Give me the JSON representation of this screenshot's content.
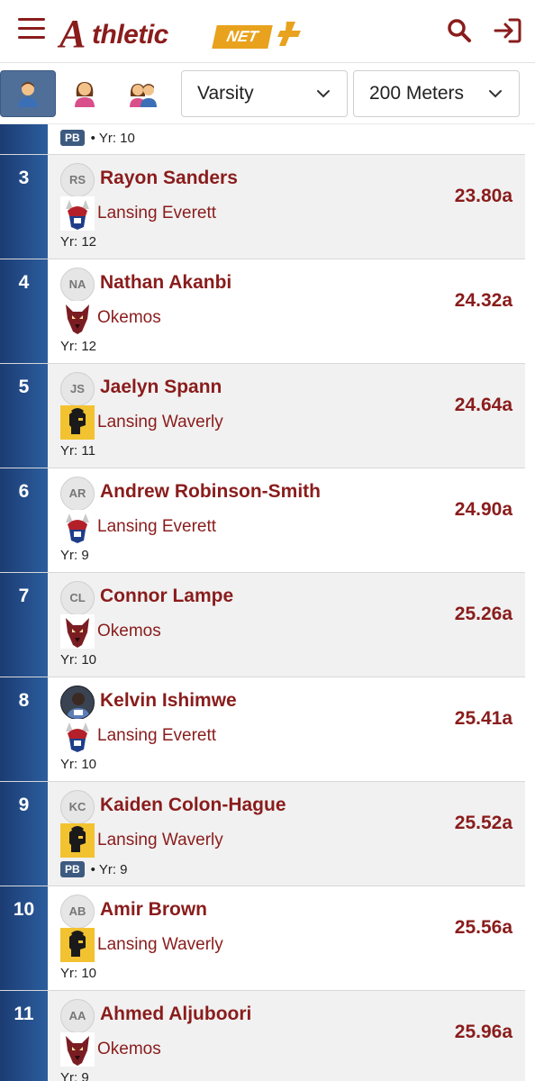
{
  "header": {
    "logo_text_a": "A",
    "logo_text": "thletic",
    "logo_net": "NET"
  },
  "filters": {
    "level": "Varsity",
    "event": "200 Meters",
    "gender_buttons": [
      "boys-icon",
      "girls-icon",
      "both-genders-icon"
    ],
    "active_gender": "boys"
  },
  "partial_row": {
    "pb": "PB",
    "meta": "• Yr: 10"
  },
  "rows": [
    {
      "rank": "3",
      "initials": "RS",
      "name": "Rayon Sanders",
      "school": "Lansing Everett",
      "school_logo": "viking",
      "meta": "Yr: 12",
      "pb": "",
      "mark": "23.80a"
    },
    {
      "rank": "4",
      "initials": "NA",
      "name": "Nathan Akanbi",
      "school": "Okemos",
      "school_logo": "wolf",
      "meta": "Yr: 12",
      "pb": "",
      "mark": "24.32a"
    },
    {
      "rank": "5",
      "initials": "JS",
      "name": "Jaelyn Spann",
      "school": "Lansing Waverly",
      "school_logo": "warrior",
      "meta": "Yr: 11",
      "pb": "",
      "mark": "24.64a"
    },
    {
      "rank": "6",
      "initials": "AR",
      "name": "Andrew Robinson-Smith",
      "school": "Lansing Everett",
      "school_logo": "viking",
      "meta": "Yr: 9",
      "pb": "",
      "mark": "24.90a"
    },
    {
      "rank": "7",
      "initials": "CL",
      "name": "Connor Lampe",
      "school": "Okemos",
      "school_logo": "wolf",
      "meta": "Yr: 10",
      "pb": "",
      "mark": "25.26a"
    },
    {
      "rank": "8",
      "initials": "",
      "name": "Kelvin Ishimwe",
      "school": "Lansing Everett",
      "school_logo": "viking",
      "meta": "Yr: 10",
      "pb": "",
      "mark": "25.41a",
      "photo": true
    },
    {
      "rank": "9",
      "initials": "KC",
      "name": "Kaiden Colon-Hague",
      "school": "Lansing Waverly",
      "school_logo": "warrior",
      "meta": "• Yr: 9",
      "pb": "PB",
      "mark": "25.52a"
    },
    {
      "rank": "10",
      "initials": "AB",
      "name": "Amir Brown",
      "school": "Lansing Waverly",
      "school_logo": "warrior",
      "meta": "Yr: 10",
      "pb": "",
      "mark": "25.56a"
    },
    {
      "rank": "11",
      "initials": "AA",
      "name": "Ahmed Aljuboori",
      "school": "Okemos",
      "school_logo": "wolf",
      "meta": "Yr: 9",
      "pb": "",
      "mark": "25.96a"
    }
  ],
  "colors": {
    "brand": "#8a1c1c",
    "accent": "#e8a21e",
    "rank_bg": "#1b3c73",
    "pb_badge": "#3d5a80"
  }
}
